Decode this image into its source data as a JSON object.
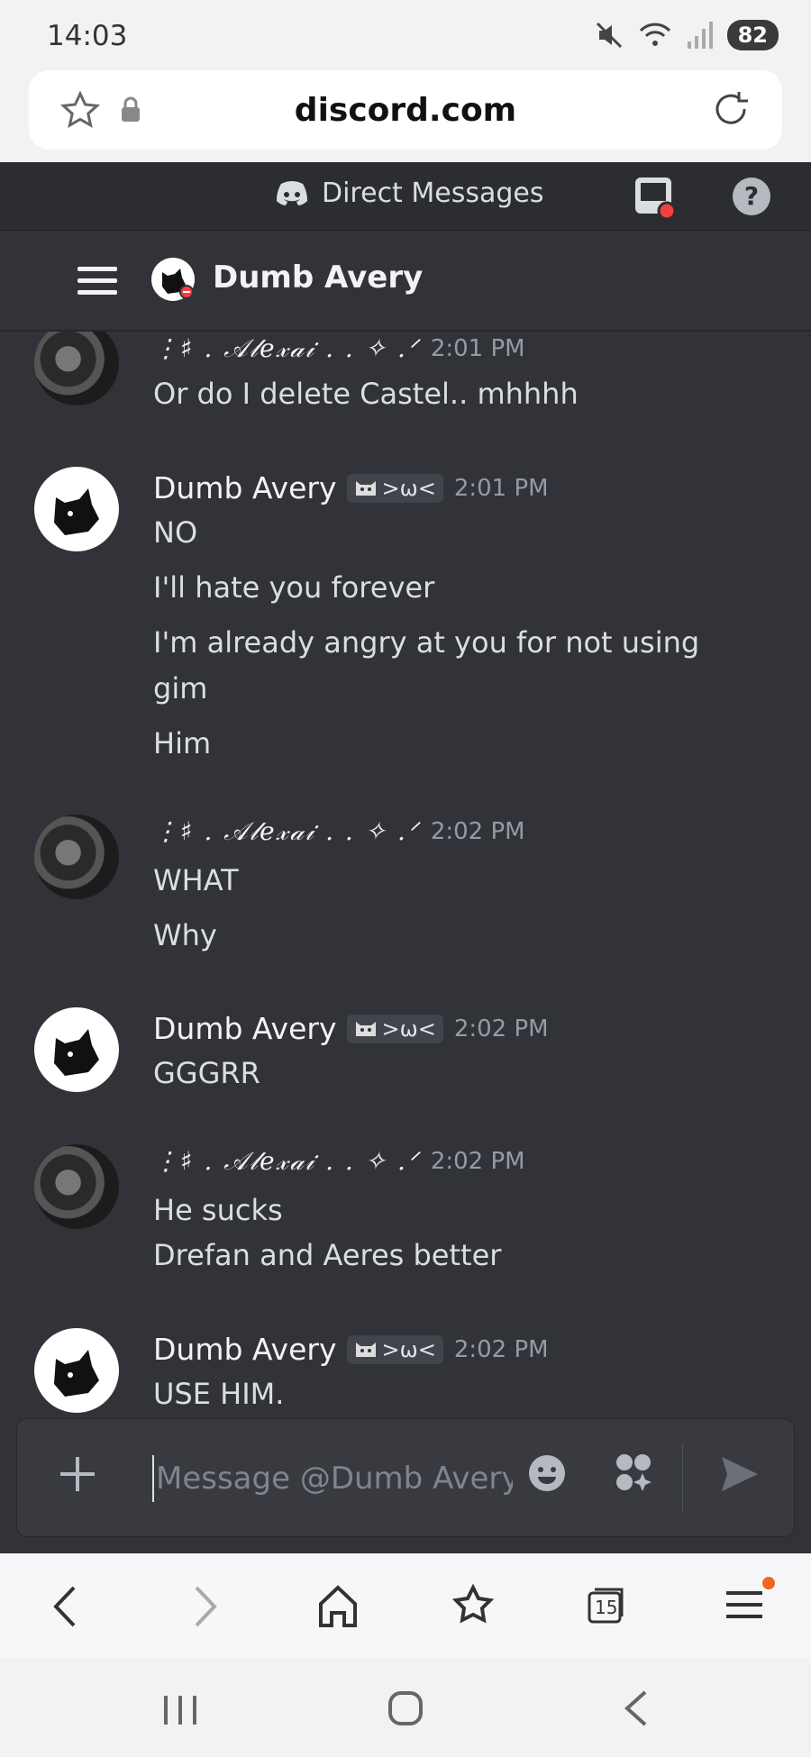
{
  "status_bar": {
    "time": "14:03",
    "battery": "82"
  },
  "browser": {
    "url": "discord.com"
  },
  "discord": {
    "header_title": "Direct Messages",
    "channel_name": "Dumb Avery",
    "composer_placeholder": "Message @Dumb Avery"
  },
  "messages": [
    {
      "author": "⋮♯ . 𝒜𝓁𝑒𝓍𝒶𝒾 . . ✧ .ᐟ",
      "time": "2:01 PM",
      "lines": [
        "Or do I delete Castel.. mhhhh"
      ]
    },
    {
      "author": "Dumb Avery",
      "tag": ">ω<",
      "time": "2:01 PM",
      "lines": [
        "NO",
        "I'll hate you forever",
        "I'm already angry at you for not using",
        "gim",
        "Him"
      ]
    },
    {
      "author": "⋮♯ . 𝒜𝓁𝑒𝓍𝒶𝒾 . . ✧ .ᐟ",
      "time": "2:02 PM",
      "lines": [
        "WHAT",
        "Why"
      ]
    },
    {
      "author": "Dumb Avery",
      "tag": ">ω<",
      "time": "2:02 PM",
      "lines": [
        "GGGRR"
      ]
    },
    {
      "author": "⋮♯ . 𝒜𝓁𝑒𝓍𝒶𝒾 . . ✧ .ᐟ",
      "time": "2:02 PM",
      "lines": [
        "He sucks",
        "Drefan and Aeres better"
      ]
    },
    {
      "author": "Dumb Avery",
      "tag": ">ω<",
      "time": "2:02 PM",
      "lines": [
        "USE HIM."
      ]
    }
  ],
  "tabs_count": "15",
  "colors": {
    "background": "#313338",
    "accent_notification": "#f23f42"
  }
}
